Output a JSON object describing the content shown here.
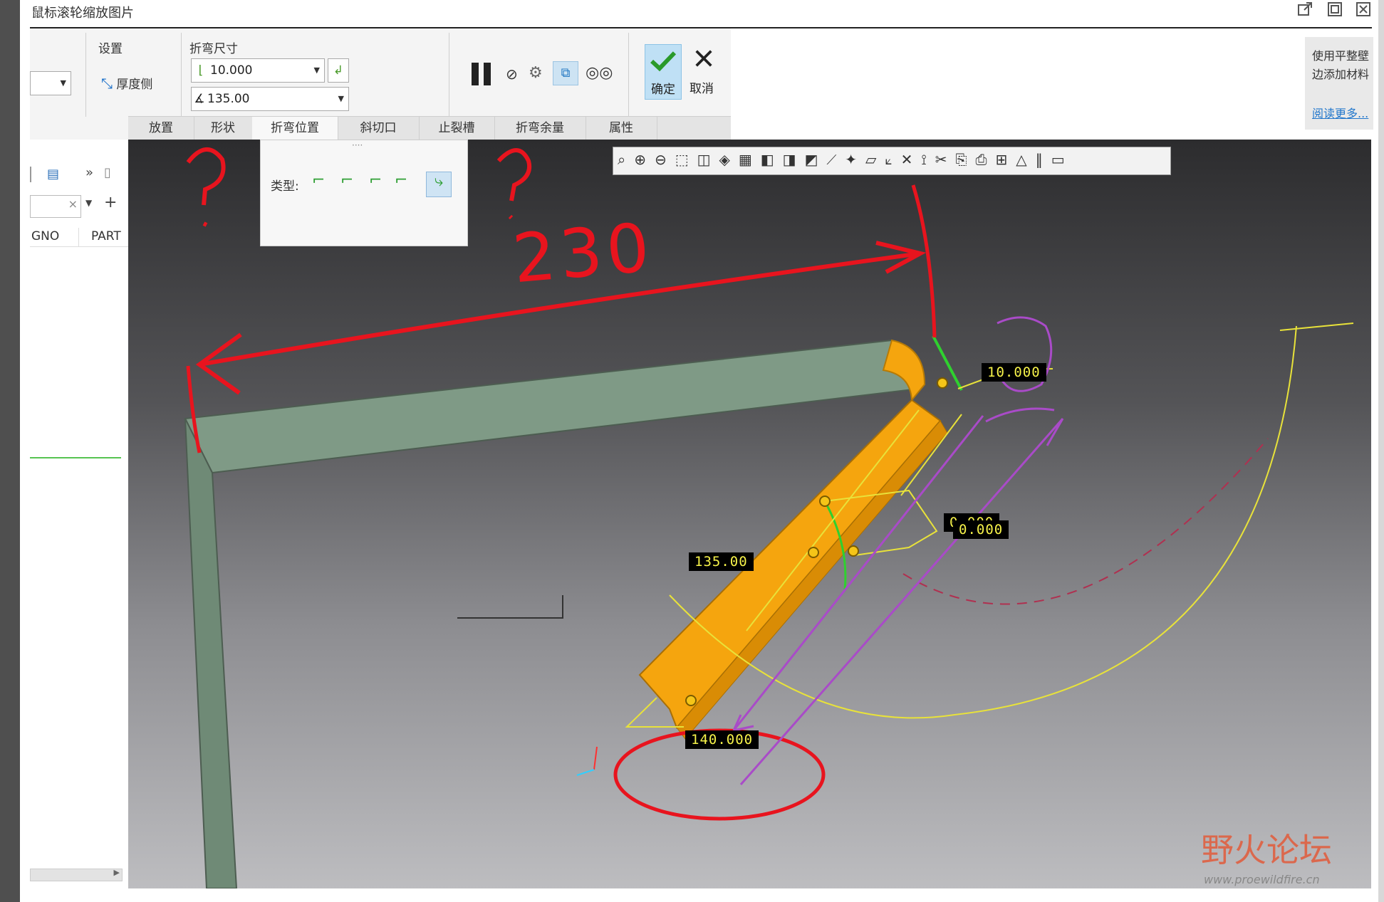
{
  "window": {
    "title": "鼠标滚轮缩放图片"
  },
  "ribbon": {
    "settings": {
      "label": "设置",
      "thickness_side": "厚度侧"
    },
    "bend_dimension": {
      "label": "折弯尺寸",
      "radius_value": "10.000",
      "angle_value": "135.00"
    },
    "ok_label": "确定",
    "cancel_label": "取消",
    "tabs": [
      "放置",
      "形状",
      "折弯位置",
      "斜切口",
      "止裂槽",
      "折弯余量",
      "属性"
    ],
    "active_tab": "折弯位置"
  },
  "right_panel": {
    "line1": "使用平整壁",
    "line2": "边添加材料",
    "link": "阅读更多..."
  },
  "left_tree": {
    "col1": "GNO",
    "col2": "PART"
  },
  "flyout": {
    "type_label": "类型:"
  },
  "dimensions": {
    "radius_tag": "10.000",
    "depth_a": "0.000",
    "depth_b": "0.000",
    "angle": "135.00",
    "length": "140.000"
  },
  "annotations": {
    "handwritten_length": "230"
  },
  "watermark": {
    "text": "野火论坛",
    "url": "www.proewildfire.cn"
  },
  "colors": {
    "wall": "#7f9a86",
    "flange": "#f5a50e",
    "markup_red": "#e8141e",
    "markup_purple": "#a94bc8",
    "dim_text": "#f7f34a",
    "ok_bg": "#bfe0f5"
  }
}
